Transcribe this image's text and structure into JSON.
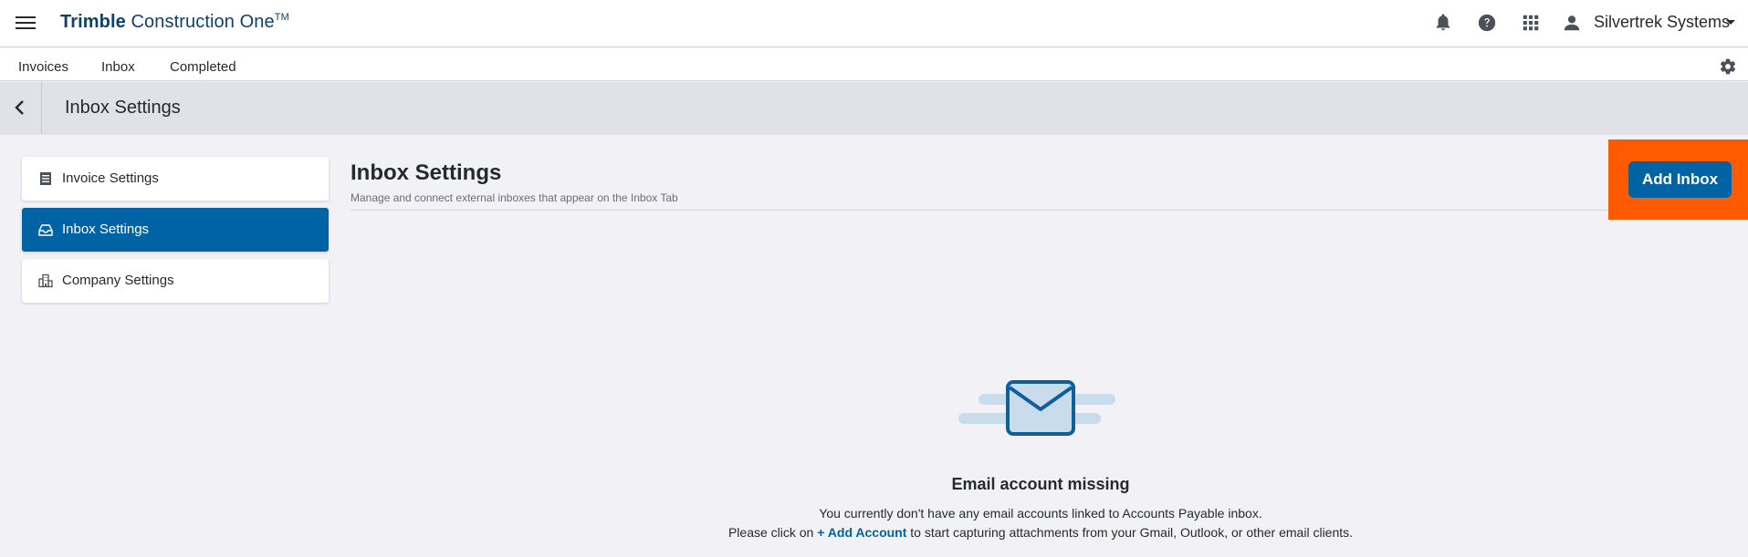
{
  "topbar": {
    "brand_bold": "Trimble",
    "brand_rest": " Construction One",
    "brand_tm": "TM",
    "user_name": "Silvertrek Systems",
    "icons": [
      "menu-icon",
      "bell-icon",
      "help-icon",
      "apps-grid-icon",
      "user-icon",
      "caret-down-icon"
    ]
  },
  "tabs": [
    {
      "label": "Invoices"
    },
    {
      "label": "Inbox"
    },
    {
      "label": "Completed"
    }
  ],
  "page_header": {
    "title": "Inbox Settings"
  },
  "sidebar": {
    "items": [
      {
        "label": "Invoice Settings",
        "icon": "list-icon",
        "active": false
      },
      {
        "label": "Inbox Settings",
        "icon": "inbox-icon",
        "active": true
      },
      {
        "label": "Company Settings",
        "icon": "building-icon",
        "active": false
      }
    ]
  },
  "main": {
    "title": "Inbox Settings",
    "subtitle": "Manage and connect external inboxes that appear on the Inbox Tab",
    "add_button": "Add Inbox"
  },
  "empty_state": {
    "title": "Email account missing",
    "line1": "You currently don't have any email accounts linked to Accounts Payable inbox.",
    "line2_prefix": "Please click on ",
    "line2_link": "+ Add Account",
    "line2_suffix": " to start capturing attachments from your Gmail, Outlook, or other email clients."
  },
  "colors": {
    "primary": "#0063a3",
    "brand": "#0e416c",
    "highlight": "#ff5a00",
    "background": "#f1f1f6",
    "header_band": "#e1e1e9"
  }
}
